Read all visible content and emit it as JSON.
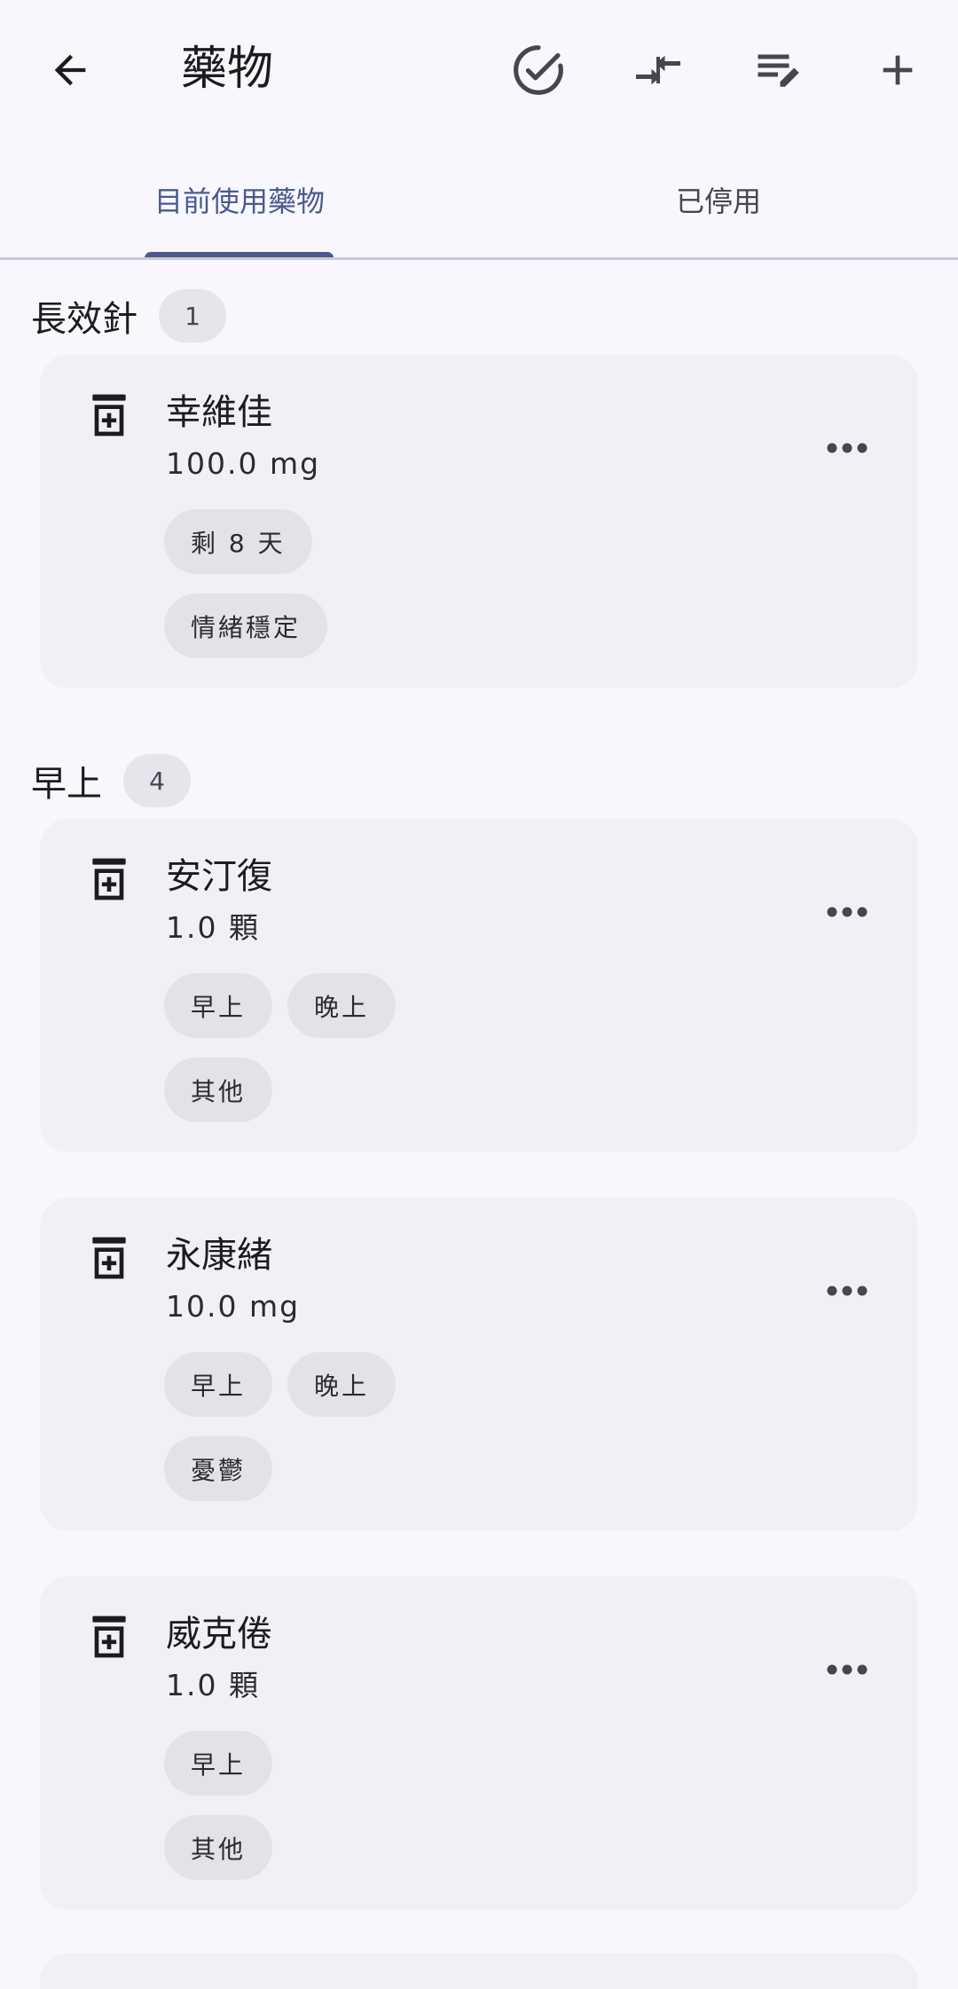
{
  "appbar": {
    "title": "藥物",
    "back_icon": "arrow-back-icon",
    "actions": [
      "check-circle-icon",
      "compare-arrows-icon",
      "edit-list-icon",
      "add-icon"
    ]
  },
  "tabs": [
    {
      "label": "目前使用藥物",
      "active": true
    },
    {
      "label": "已停用",
      "active": false
    }
  ],
  "sections": [
    {
      "label": "長效針",
      "count": "1",
      "cards": [
        {
          "name": "幸維佳",
          "dose": "100.0 mg",
          "chips": [
            [
              "剩 8 天"
            ],
            [
              "情緒穩定"
            ]
          ]
        }
      ]
    },
    {
      "label": "早上",
      "count": "4",
      "cards": [
        {
          "name": "安汀復",
          "dose": "1.0 顆",
          "chips": [
            [
              "早上",
              "晚上"
            ],
            [
              "其他"
            ]
          ]
        },
        {
          "name": "永康緒",
          "dose": "10.0 mg",
          "chips": [
            [
              "早上",
              "晚上"
            ],
            [
              "憂鬱"
            ]
          ]
        },
        {
          "name": "威克倦",
          "dose": "1.0 顆",
          "chips": [
            [
              "早上"
            ],
            [
              "其他"
            ]
          ]
        }
      ]
    }
  ],
  "colors": {
    "background": "#f8f7fd",
    "card": "#f1f0f6",
    "chip": "#e3e2e9",
    "accent": "#4a5a8f"
  }
}
